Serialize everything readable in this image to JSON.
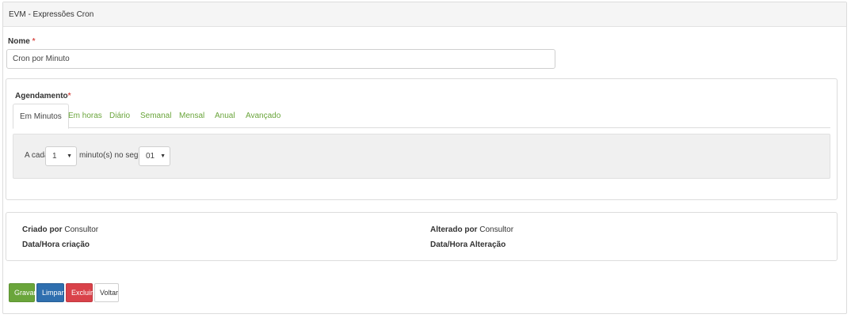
{
  "panel": {
    "title": "EVM - Expressões Cron"
  },
  "form": {
    "name_label": "Nome",
    "required_marker": "*",
    "name_value": "Cron por Minuto"
  },
  "schedule": {
    "label": "Agendamento",
    "required_marker": "*",
    "tabs": [
      {
        "label": "Em Minutos",
        "active": true
      },
      {
        "label": "Em horas",
        "active": false
      },
      {
        "label": "Diário",
        "active": false
      },
      {
        "label": "Semanal",
        "active": false
      },
      {
        "label": "Mensal",
        "active": false
      },
      {
        "label": "Anual",
        "active": false
      },
      {
        "label": "Avançado",
        "active": false
      }
    ],
    "every_text": "A cada",
    "minutes_value": "1",
    "minutes_text": "minuto(s) no segundo",
    "seconds_value": "01"
  },
  "audit": {
    "created_by_label": "Criado por",
    "created_by_value": "Consultor",
    "created_at_label": "Data/Hora criação",
    "changed_by_label": "Alterado por",
    "changed_by_value": "Consultor",
    "changed_at_label": "Data/Hora Alteração"
  },
  "buttons": {
    "save": "Gravar",
    "clear": "Limpar",
    "delete": "Excluir",
    "back": "Voltar"
  },
  "colors": {
    "accent_green": "#6aa53b",
    "primary_blue": "#2f6faf",
    "danger_red": "#d9424a"
  }
}
